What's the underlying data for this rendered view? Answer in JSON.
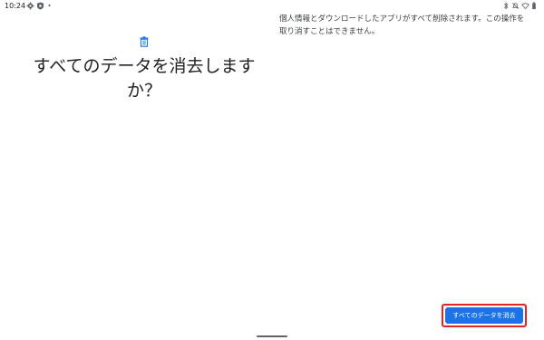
{
  "status_bar": {
    "time": "10:24",
    "left_icons": [
      "gear-icon",
      "shield-icon",
      "dot-icon"
    ],
    "right_icons": [
      "bluetooth-icon",
      "mute-icon",
      "wifi-icon",
      "battery-icon"
    ]
  },
  "left_pane": {
    "icon": "trash-icon",
    "title": "すべてのデータを消去しますか？"
  },
  "right_pane": {
    "description": "個人情報とダウンロードしたアプリがすべて削除されます。この操作を取り消すことはできません。"
  },
  "actions": {
    "erase_label": "すべてのデータを消去"
  },
  "colors": {
    "accent": "#1a73e8",
    "highlight": "#e8231e",
    "text": "#202124",
    "background": "#ffffff"
  }
}
